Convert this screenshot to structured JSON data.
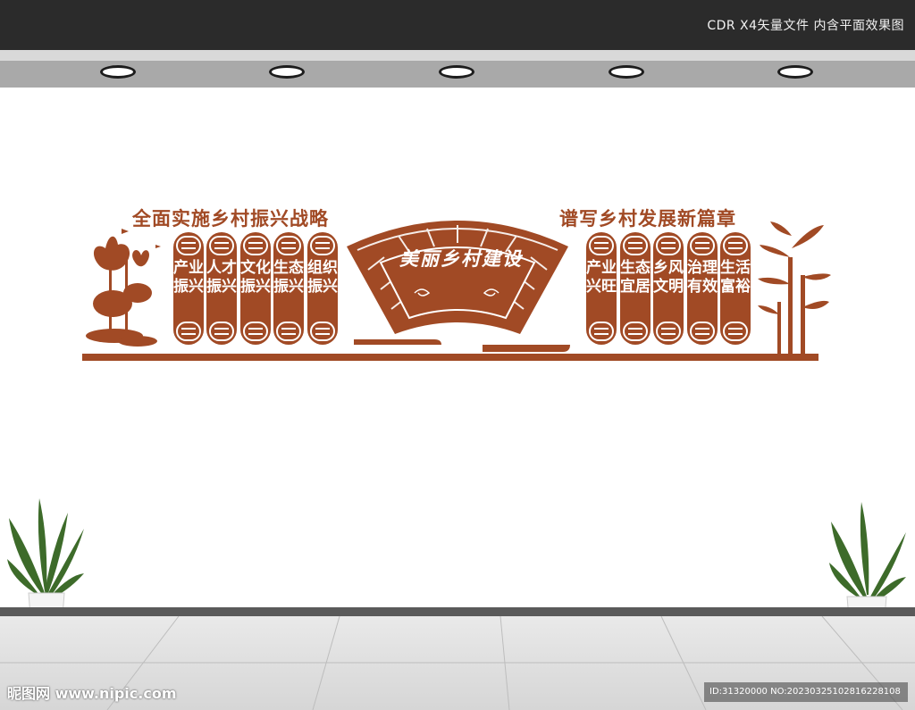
{
  "header": {
    "label": "CDR X4矢量文件  内含平面效果图"
  },
  "left_slogan": "全面实施乡村振兴战略",
  "right_slogan": "谱写乡村发展新篇章",
  "center_title": "美丽乡村建设",
  "left_panels": [
    "产业振兴",
    "人才振兴",
    "文化振兴",
    "生态振兴",
    "组织振兴"
  ],
  "right_panels": [
    "产业兴旺",
    "生态宜居",
    "乡风文明",
    "治理有效",
    "生活富裕"
  ],
  "colors": {
    "accent": "#a14a25",
    "topbar": "#2b2b2b"
  },
  "footer": {
    "watermark": "昵图网 www.nipic.com",
    "id_text": "ID:31320000 NO:20230325102816228108"
  }
}
